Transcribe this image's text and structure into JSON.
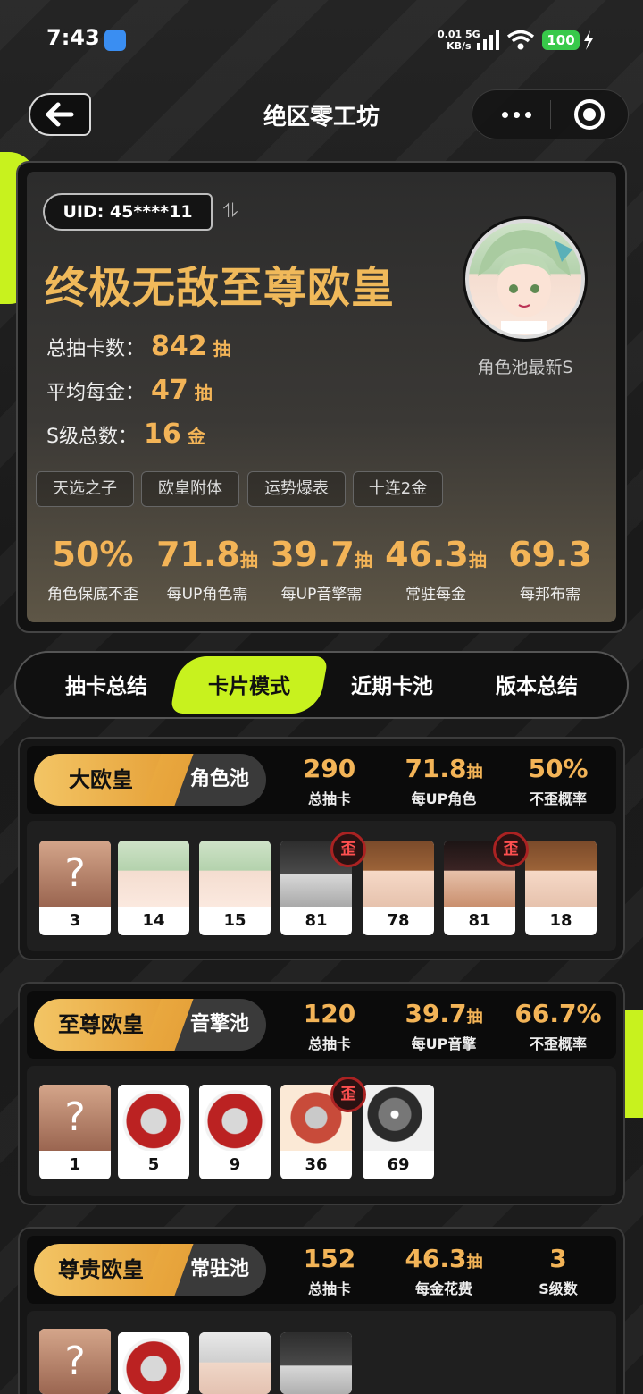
{
  "status": {
    "time": "7:43",
    "net_speed": "0.01",
    "net_unit": "KB/s",
    "net_type": "5G",
    "battery": "100"
  },
  "nav": {
    "title": "绝区零工坊"
  },
  "profile": {
    "uid": "UID: 45****11",
    "title": "终极无敌至尊欧皇",
    "stats": [
      {
        "label": "总抽卡数：",
        "value": "842",
        "unit": "抽"
      },
      {
        "label": "平均每金：",
        "value": "47",
        "unit": "抽"
      },
      {
        "label": "S级总数：",
        "value": "16",
        "unit": "金"
      }
    ],
    "avatar_label": "角色池最新S",
    "tags": [
      "天选之子",
      "欧皇附体",
      "运势爆表",
      "十连2金"
    ],
    "kpis": [
      {
        "value": "50%",
        "unit": "",
        "label": "角色保底不歪"
      },
      {
        "value": "71.8",
        "unit": "抽",
        "label": "每UP角色需"
      },
      {
        "value": "39.7",
        "unit": "抽",
        "label": "每UP音擎需"
      },
      {
        "value": "46.3",
        "unit": "抽",
        "label": "常驻每金"
      },
      {
        "value": "69.3",
        "unit": "",
        "label": "每邦布需"
      }
    ]
  },
  "tabs": [
    "抽卡总结",
    "卡片模式",
    "近期卡池",
    "版本总结"
  ],
  "active_tab": "卡片模式",
  "pools": [
    {
      "rank": "大欧皇",
      "pool": "角色池",
      "stats": [
        {
          "value": "290",
          "unit": "",
          "label": "总抽卡"
        },
        {
          "value": "71.8",
          "unit": "抽",
          "label": "每UP角色"
        },
        {
          "value": "50%",
          "unit": "",
          "label": "不歪概率"
        }
      ],
      "items": [
        {
          "num": "3",
          "type": "unknown"
        },
        {
          "num": "14",
          "type": "char-hair-g"
        },
        {
          "num": "15",
          "type": "char-hair-g"
        },
        {
          "num": "81",
          "type": "char-dark",
          "wai": "歪"
        },
        {
          "num": "78",
          "type": "char-brown"
        },
        {
          "num": "81",
          "type": "char-black",
          "wai": "歪"
        },
        {
          "num": "18",
          "type": "char-brown"
        }
      ]
    },
    {
      "rank": "至尊欧皇",
      "pool": "音擎池",
      "stats": [
        {
          "value": "120",
          "unit": "",
          "label": "总抽卡"
        },
        {
          "value": "39.7",
          "unit": "抽",
          "label": "每UP音擎"
        },
        {
          "value": "66.7%",
          "unit": "",
          "label": "不歪概率"
        }
      ],
      "items": [
        {
          "num": "1",
          "type": "unknown"
        },
        {
          "num": "5",
          "type": "engine-red"
        },
        {
          "num": "9",
          "type": "engine-red"
        },
        {
          "num": "36",
          "type": "engine-ball2",
          "wai": "歪"
        },
        {
          "num": "69",
          "type": "engine-ball"
        }
      ]
    },
    {
      "rank": "尊贵欧皇",
      "pool": "常驻池",
      "stats": [
        {
          "value": "152",
          "unit": "",
          "label": "总抽卡"
        },
        {
          "value": "46.3",
          "unit": "抽",
          "label": "每金花费"
        },
        {
          "value": "3",
          "unit": "",
          "label": "S级数"
        }
      ],
      "items": [
        {
          "num": "",
          "type": "unknown"
        },
        {
          "num": "",
          "type": "engine-red"
        },
        {
          "num": "",
          "type": "char-white"
        },
        {
          "num": "",
          "type": "char-dark"
        }
      ]
    }
  ],
  "symbols": {
    "unknown": "?",
    "swap": "⥮"
  },
  "colors": {
    "accent": "#c8f21e",
    "gold": "#f3b457",
    "wai_red": "#ff5050"
  }
}
